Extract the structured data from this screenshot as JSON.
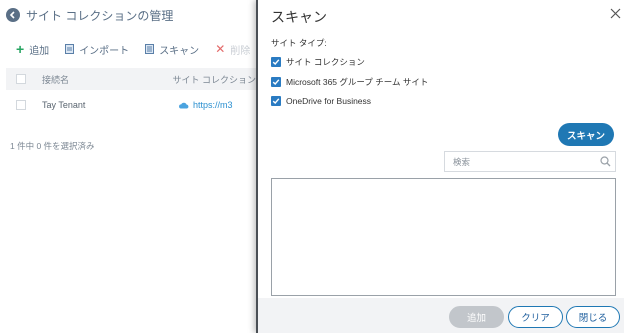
{
  "background_page": {
    "title": "サイト コレクションの管理",
    "toolbar": {
      "add": "追加",
      "import": "インポート",
      "scan": "スキャン",
      "delete": "削除"
    },
    "table": {
      "columns": [
        "接続名",
        "サイト コレクション"
      ],
      "rows": [
        {
          "name": "Tay Tenant",
          "url": "https://m3"
        }
      ]
    },
    "selection_status": "1 件中 0 件を選択済み"
  },
  "modal": {
    "title": "スキャン",
    "site_type_label": "サイト タイプ:",
    "options": [
      {
        "label": "サイト コレクション",
        "checked": true
      },
      {
        "label": "Microsoft 365 グループ チーム サイト",
        "checked": true
      },
      {
        "label": "OneDrive for Business",
        "checked": true
      }
    ],
    "scan_button": "スキャン",
    "search": {
      "placeholder": "検索",
      "value": ""
    },
    "footer": {
      "add": "追加",
      "clear": "クリア",
      "close": "閉じる"
    }
  },
  "colors": {
    "accent": "#1f78b4",
    "checkbox": "#2a7bc2",
    "add_icon": "#27a562",
    "link": "#2a8fd0"
  }
}
